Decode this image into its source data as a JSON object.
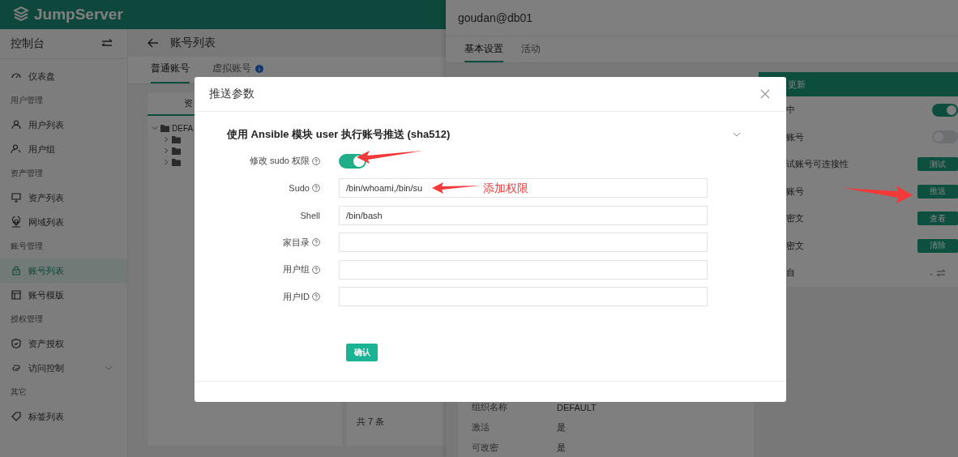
{
  "brand": {
    "name": "JumpServer"
  },
  "sidebar": {
    "title": "控制台",
    "sections": [
      {
        "items": [
          {
            "label": "仪表盘",
            "selected": false
          }
        ]
      },
      {
        "heading": "用户管理",
        "items": [
          {
            "label": "用户列表",
            "selected": false
          },
          {
            "label": "用户组",
            "selected": false
          }
        ]
      },
      {
        "heading": "资产管理",
        "items": [
          {
            "label": "资产列表",
            "selected": false
          },
          {
            "label": "网域列表",
            "selected": false
          }
        ]
      },
      {
        "heading": "账号管理",
        "items": [
          {
            "label": "账号列表",
            "selected": true
          },
          {
            "label": "账号模版",
            "selected": false
          }
        ]
      },
      {
        "heading": "授权管理",
        "items": [
          {
            "label": "资产授权",
            "selected": false
          },
          {
            "label": "访问控制",
            "selected": false,
            "expanded": false
          }
        ]
      },
      {
        "heading": "其它",
        "items": [
          {
            "label": "标签列表",
            "selected": false
          }
        ]
      }
    ]
  },
  "page": {
    "title": "账号列表",
    "tabs": [
      {
        "label": "普通账号",
        "selected": true
      },
      {
        "label": "虚拟账号",
        "selected": false
      }
    ],
    "tree_tab": "资",
    "tree": [
      {
        "label": "DEFA",
        "expanded": true,
        "children": [
          {
            "expanded": false
          },
          {
            "expanded": false
          },
          {
            "expanded": false
          }
        ]
      }
    ],
    "total": "共 7 条"
  },
  "drawer": {
    "title": "goudan@db01",
    "tabs": [
      {
        "label": "基本设置",
        "selected": true
      },
      {
        "label": "活动",
        "selected": false
      }
    ],
    "quick_panel": {
      "title": "更新",
      "rows": [
        {
          "kind": "switch",
          "label": "中",
          "on": true
        },
        {
          "kind": "switch",
          "label": "账号",
          "on": false
        },
        {
          "kind": "button",
          "label": "试账号可连接性",
          "button": "测试"
        },
        {
          "kind": "button",
          "label": "账号",
          "button": "推送"
        },
        {
          "kind": "button",
          "label": "密文",
          "button": "查看"
        },
        {
          "kind": "button",
          "label": "密文",
          "button": "清除"
        },
        {
          "kind": "value",
          "label": "自",
          "value": "-"
        }
      ]
    },
    "details": [
      {
        "label": "组织名称",
        "value": "DEFAULT"
      },
      {
        "label": "激活",
        "value": "是"
      },
      {
        "label": "可改密",
        "value": "是"
      }
    ]
  },
  "dialog": {
    "title": "推送参数",
    "section": {
      "title": "使用 Ansible 模块 user 执行账号推送 (sha512)",
      "expanded": true
    },
    "fields": [
      {
        "kind": "switch",
        "label": "修改 sudo 权限",
        "help": true,
        "on": true
      },
      {
        "kind": "input",
        "label": "Sudo",
        "help": true,
        "value": "/bin/whoami,/bin/su"
      },
      {
        "kind": "input",
        "label": "Shell",
        "help": false,
        "value": "/bin/bash"
      },
      {
        "kind": "input",
        "label": "家目录",
        "help": true
      },
      {
        "kind": "input",
        "label": "用户组",
        "help": true
      },
      {
        "kind": "input",
        "label": "用户ID",
        "help": true
      }
    ],
    "confirm": "确认"
  },
  "annotation": {
    "text": "添加权限"
  }
}
